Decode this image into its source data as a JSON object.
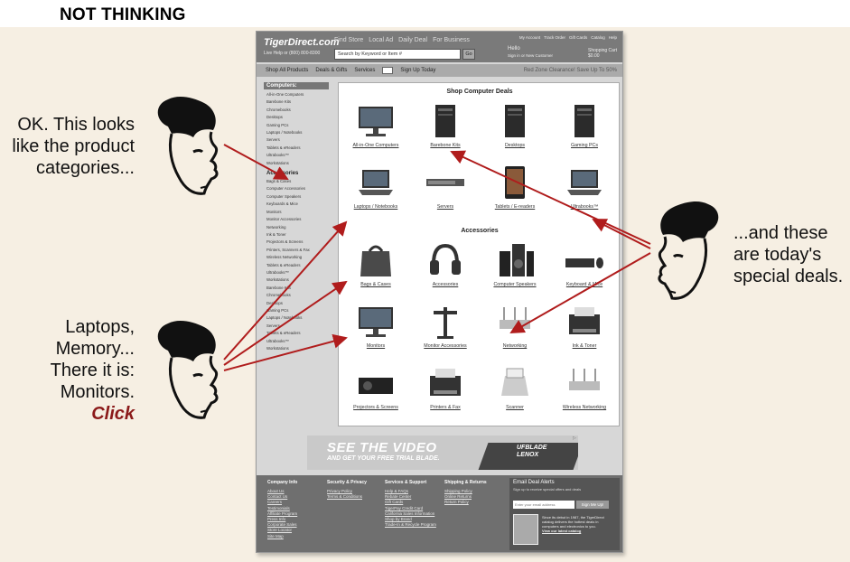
{
  "heading": "NOT THINKING",
  "captions": {
    "left_top": [
      "OK. This looks",
      "like the product",
      "categories..."
    ],
    "left_bottom": [
      "Laptops,",
      "Memory...",
      "There it is:",
      "Monitors."
    ],
    "click": "Click",
    "right": [
      "...and these",
      "are today's",
      "special deals."
    ]
  },
  "site": {
    "logo": "TigerDirect.com",
    "live_help": "Live Help or (800) 800-8300",
    "top_nav": [
      "Find Store",
      "Local Ad",
      "Daily Deal",
      "For Business"
    ],
    "account_links": [
      "My Account",
      "Track Order",
      "Gift Cards",
      "Catalog",
      "Help"
    ],
    "search_placeholder": "Search by Keyword or Item #",
    "go_label": "Go",
    "hello": "Hello",
    "hello_sub": "Sign in or New Customer",
    "cart_label": "Shopping Cart",
    "cart_amount": "$0.00",
    "nav": [
      "Shop All Products",
      "Deals & Gifts",
      "Services",
      "Sign Up Today"
    ],
    "promo": "Red Zone Clearance! Save Up To 50%",
    "sidebar": {
      "computers_heading": "Computers:",
      "computers": [
        "All-in-One Computers",
        "Barebone Kits",
        "Chromebooks",
        "Desktops",
        "Gaming PCs",
        "Laptops / Notebooks",
        "Servers",
        "Tablets & eReaders",
        "Ultrabooks™",
        "Workstations"
      ],
      "accessories_heading": "Accessories",
      "accessories": [
        "Bags & Cases",
        "Computer Accessories",
        "Computer Speakers",
        "Keyboards & Mice",
        "Monitors",
        "Monitor Accessories",
        "Networking",
        "Ink & Toner",
        "Projectors & Screens",
        "Printers, Scanners & Fax",
        "Wireless Networking",
        "Tablets & eReaders",
        "Ultrabooks™",
        "Workstations",
        "Barebone Kits",
        "Chromebooks",
        "Desktops",
        "Gaming PCs",
        "Laptops / Notebooks",
        "Servers",
        "Tablets & eReaders",
        "Ultrabooks™",
        "Workstations"
      ]
    },
    "deals_title": "Shop Computer Deals",
    "deals": [
      "All-in-One Computers",
      "Barebone Kits",
      "Desktops",
      "Gaming PCs",
      "Laptops / Notebooks",
      "Servers",
      "Tablets / E-readers",
      "Ultrabooks™"
    ],
    "accessories_title": "Accessories",
    "accessories": [
      "Bags & Cases",
      "Accessories",
      "Computer Speakers",
      "Keyboard & Mice",
      "Monitors",
      "Monitor Accessories",
      "Networking",
      "Ink & Toner",
      "Projectors & Screens",
      "Printers & Fax",
      "Scanner",
      "Wireless Networking"
    ],
    "banner": {
      "line1": "SEE THE VIDEO",
      "line2": "AND GET YOUR FREE TRIAL BLADE.",
      "brand1": "UFBLADE",
      "brand2": "LENOX"
    },
    "footer": {
      "cols": [
        {
          "title": "Company Info",
          "links": [
            "About Us",
            "Contact Us",
            "Careers",
            "Testimonials",
            "Affiliate Program",
            "Press Info",
            "Corporate Sales",
            "Store Locator",
            "Site Map"
          ]
        },
        {
          "title": "Security & Privacy",
          "links": [
            "Privacy Policy",
            "Terms & Conditions"
          ]
        },
        {
          "title": "Services & Support",
          "links": [
            "Help & FAQs",
            "Rebate Center",
            "Gift Cards",
            "TigerPay Credit Card",
            "California Sales Information",
            "Shop by Brand",
            "Trade-In & Recycle Program"
          ]
        },
        {
          "title": "Shipping & Returns",
          "links": [
            "Shipping Policy",
            "Online Returns",
            "Return Policy"
          ]
        }
      ],
      "email_title": "Email Deal Alerts",
      "email_sub": "Sign up to receive special offers and deals",
      "email_placeholder": "Enter your email address",
      "email_button": "Sign Me Up!",
      "catalog_text": "Since its debut in 1987, the TigerDirect catalog delivers the hottest deals in computers and electronics to you.",
      "catalog_link": "View our latest catalog"
    }
  }
}
